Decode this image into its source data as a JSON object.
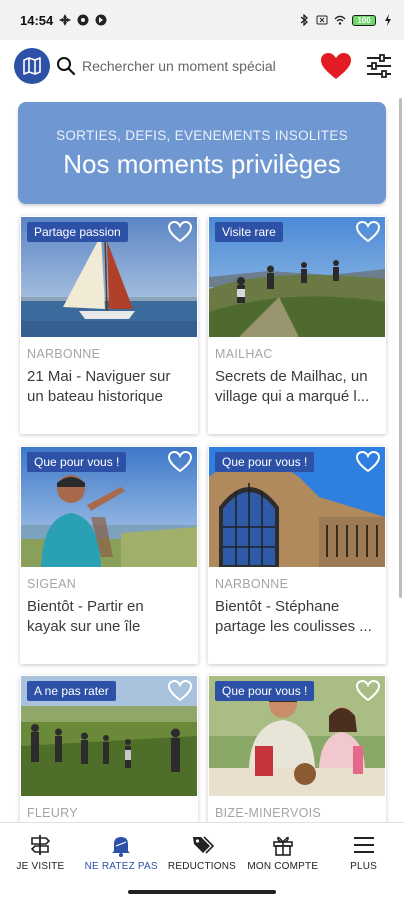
{
  "status_bar": {
    "time": "14:54",
    "battery": "100"
  },
  "header": {
    "map_icon": "map-icon",
    "search_placeholder": "Rechercher un moment spécial",
    "favorites_icon": "heart-icon",
    "filter_icon": "filter-sliders-icon",
    "accent_color": "#2e51a8",
    "heart_color": "#e31b23"
  },
  "hero": {
    "subtitle": "SORTIES, DEFIS, EVENEMENTS INSOLITES",
    "title": "Nos moments privilèges",
    "color": "#6f97d1"
  },
  "cards": [
    {
      "tag": "Partage passion",
      "city": "NARBONNE",
      "title_line1": "21 Mai - Naviguer sur",
      "title_line2": "un bateau historique",
      "image": "sailboat-photo"
    },
    {
      "tag": "Visite rare",
      "city": "MAILHAC",
      "title_line1": "Secrets de Mailhac, un",
      "title_line2": "village qui a marqué l...",
      "image": "hikers-photo"
    },
    {
      "tag": "Que pour vous !",
      "city": "SIGEAN",
      "title_line1": "Bientôt - Partir en",
      "title_line2": "kayak sur une île",
      "image": "lagoon-man-photo"
    },
    {
      "tag": "Que pour vous !",
      "city": "NARBONNE",
      "title_line1": "Bientôt - Stéphane",
      "title_line2": "partage les coulisses ...",
      "image": "cathedral-window-photo"
    },
    {
      "tag": "A ne pas rater",
      "city": "FLEURY",
      "title_line1": "",
      "title_line2": "",
      "image": "vineyard-photo"
    },
    {
      "tag": "Que pour vous !",
      "city": "BIZE-MINERVOIS",
      "title_line1": "",
      "title_line2": "",
      "image": "picnic-photo"
    }
  ],
  "nav": [
    {
      "label": "JE VISITE",
      "icon": "signpost-icon"
    },
    {
      "label": "NE RATEZ PAS",
      "icon": "bell-icon",
      "active": true
    },
    {
      "label": "REDUCTIONS",
      "icon": "tags-icon"
    },
    {
      "label": "MON COMPTE",
      "icon": "gift-icon"
    },
    {
      "label": "PLUS",
      "icon": "menu-icon"
    }
  ]
}
